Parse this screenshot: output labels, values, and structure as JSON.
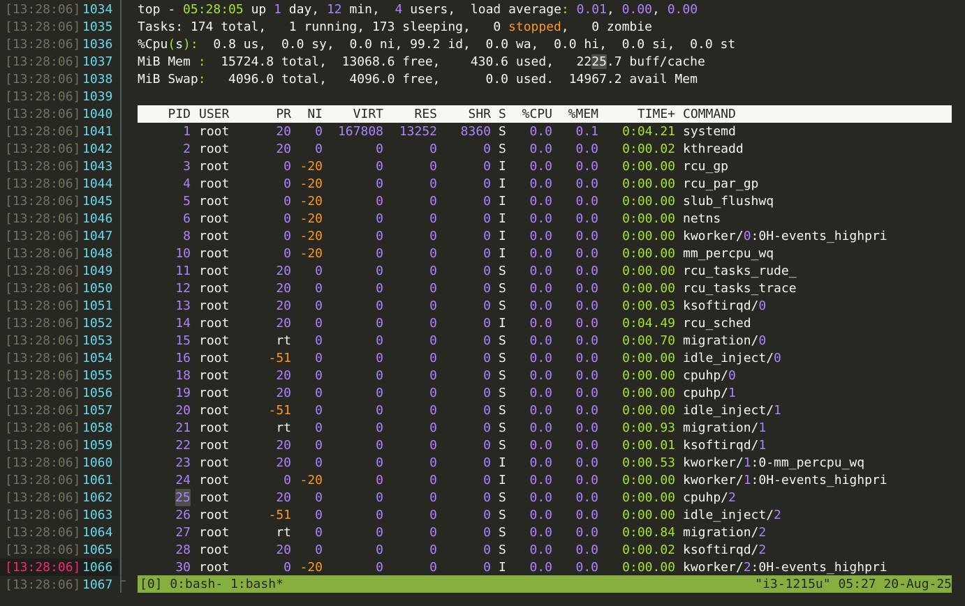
{
  "gutter": [
    {
      "ts": "[13:28:06]",
      "ln": "1034"
    },
    {
      "ts": "[13:28:06]",
      "ln": "1035"
    },
    {
      "ts": "[13:28:06]",
      "ln": "1036"
    },
    {
      "ts": "[13:28:06]",
      "ln": "1037"
    },
    {
      "ts": "[13:28:06]",
      "ln": "1038"
    },
    {
      "ts": "[13:28:06]",
      "ln": "1039"
    },
    {
      "ts": "[13:28:06]",
      "ln": "1040"
    },
    {
      "ts": "[13:28:06]",
      "ln": "1041"
    },
    {
      "ts": "[13:28:06]",
      "ln": "1042"
    },
    {
      "ts": "[13:28:06]",
      "ln": "1043"
    },
    {
      "ts": "[13:28:06]",
      "ln": "1044"
    },
    {
      "ts": "[13:28:06]",
      "ln": "1045"
    },
    {
      "ts": "[13:28:06]",
      "ln": "1046"
    },
    {
      "ts": "[13:28:06]",
      "ln": "1047"
    },
    {
      "ts": "[13:28:06]",
      "ln": "1048"
    },
    {
      "ts": "[13:28:06]",
      "ln": "1049"
    },
    {
      "ts": "[13:28:06]",
      "ln": "1050"
    },
    {
      "ts": "[13:28:06]",
      "ln": "1051"
    },
    {
      "ts": "[13:28:06]",
      "ln": "1052"
    },
    {
      "ts": "[13:28:06]",
      "ln": "1053"
    },
    {
      "ts": "[13:28:06]",
      "ln": "1054"
    },
    {
      "ts": "[13:28:06]",
      "ln": "1055"
    },
    {
      "ts": "[13:28:06]",
      "ln": "1056"
    },
    {
      "ts": "[13:28:06]",
      "ln": "1057"
    },
    {
      "ts": "[13:28:06]",
      "ln": "1058"
    },
    {
      "ts": "[13:28:06]",
      "ln": "1059"
    },
    {
      "ts": "[13:28:06]",
      "ln": "1060"
    },
    {
      "ts": "[13:28:06]",
      "ln": "1061"
    },
    {
      "ts": "[13:28:06]",
      "ln": "1062"
    },
    {
      "ts": "[13:28:06]",
      "ln": "1063"
    },
    {
      "ts": "[13:28:06]",
      "ln": "1064"
    },
    {
      "ts": "[13:28:06]",
      "ln": "1065"
    },
    {
      "ts": "[13:28:06]",
      "ln": "1066"
    },
    {
      "ts": "[13:28:06]",
      "ln": "1067"
    }
  ],
  "summary": {
    "top_prefix": "top - ",
    "time": "05:28:05",
    "up_label": " up ",
    "up_days": "1",
    "day_label": " day, ",
    "up_min": "12",
    "min_label": " min,  ",
    "users": "4",
    "users_label": " users,  load average",
    "colon": ":",
    "load1": "0.01",
    "comma1": ", ",
    "load5": "0.00",
    "comma2": ", ",
    "load15": "0.00",
    "tasks_label": "Tasks",
    "tasks_rest1": ": 174 total,   1 running, 173 sleeping,   0 ",
    "stopped": "stopped",
    "tasks_rest2": ",   0 zombie",
    "cpu_label": "%Cpu",
    "cpu_paren_open": "(",
    "cpu_s": "s",
    "cpu_paren_close": ")",
    "cpu_colon": ":",
    "cpu_rest1": "  0.8 us,  0.0 sy,  0.0 ni, 99.2 id,  0.0 wa,  0.0 ",
    "cpu_hi": "hi",
    "cpu_rest2": ",  0.0 si,  0.0 st",
    "mem_label": "MiB Mem ",
    "mem_colon": ":",
    "mem_rest1": "  15724.8 total,  13068.6 free,    430.6 used,   22",
    "mem_hl": "25",
    "mem_rest2": ".7 buff/cache",
    "swap_label": "MiB Swap",
    "swap_colon": ":",
    "swap_rest": "   4096.0 total,   4096.0 free,      0.0 used.  14967.2 avail Mem"
  },
  "header": {
    "pid": "PID",
    "user": "USER",
    "pr": "PR",
    "ni": "NI",
    "virt": "VIRT",
    "res": "RES",
    "shr": "SHR",
    "s": "S",
    "cpu": "%CPU",
    "mem": "%MEM",
    "time": "TIME+",
    "cmd": "COMMAND"
  },
  "processes": [
    {
      "pid": "1",
      "user": "root",
      "pr": "20",
      "ni": "0",
      "virt": "167808",
      "res": "13252",
      "shr": "8360",
      "s": "S",
      "cpu": "0.0",
      "mem": "0.1",
      "time": "0:04.21",
      "cmd": "systemd"
    },
    {
      "pid": "2",
      "user": "root",
      "pr": "20",
      "ni": "0",
      "virt": "0",
      "res": "0",
      "shr": "0",
      "s": "S",
      "cpu": "0.0",
      "mem": "0.0",
      "time": "0:00.02",
      "cmd": "kthreadd"
    },
    {
      "pid": "3",
      "user": "root",
      "pr": "0",
      "ni": "-20",
      "virt": "0",
      "res": "0",
      "shr": "0",
      "s": "I",
      "cpu": "0.0",
      "mem": "0.0",
      "time": "0:00.00",
      "cmd": "rcu_gp"
    },
    {
      "pid": "4",
      "user": "root",
      "pr": "0",
      "ni": "-20",
      "virt": "0",
      "res": "0",
      "shr": "0",
      "s": "I",
      "cpu": "0.0",
      "mem": "0.0",
      "time": "0:00.00",
      "cmd": "rcu_par_gp"
    },
    {
      "pid": "5",
      "user": "root",
      "pr": "0",
      "ni": "-20",
      "virt": "0",
      "res": "0",
      "shr": "0",
      "s": "I",
      "cpu": "0.0",
      "mem": "0.0",
      "time": "0:00.00",
      "cmd": "slub_flushwq"
    },
    {
      "pid": "6",
      "user": "root",
      "pr": "0",
      "ni": "-20",
      "virt": "0",
      "res": "0",
      "shr": "0",
      "s": "I",
      "cpu": "0.0",
      "mem": "0.0",
      "time": "0:00.00",
      "cmd": "netns"
    },
    {
      "pid": "8",
      "user": "root",
      "pr": "0",
      "ni": "-20",
      "virt": "0",
      "res": "0",
      "shr": "0",
      "s": "I",
      "cpu": "0.0",
      "mem": "0.0",
      "time": "0:00.00",
      "cmd": "kworker/0:0H-events_highpri"
    },
    {
      "pid": "10",
      "user": "root",
      "pr": "0",
      "ni": "-20",
      "virt": "0",
      "res": "0",
      "shr": "0",
      "s": "I",
      "cpu": "0.0",
      "mem": "0.0",
      "time": "0:00.00",
      "cmd": "mm_percpu_wq"
    },
    {
      "pid": "11",
      "user": "root",
      "pr": "20",
      "ni": "0",
      "virt": "0",
      "res": "0",
      "shr": "0",
      "s": "S",
      "cpu": "0.0",
      "mem": "0.0",
      "time": "0:00.00",
      "cmd": "rcu_tasks_rude_"
    },
    {
      "pid": "12",
      "user": "root",
      "pr": "20",
      "ni": "0",
      "virt": "0",
      "res": "0",
      "shr": "0",
      "s": "S",
      "cpu": "0.0",
      "mem": "0.0",
      "time": "0:00.00",
      "cmd": "rcu_tasks_trace"
    },
    {
      "pid": "13",
      "user": "root",
      "pr": "20",
      "ni": "0",
      "virt": "0",
      "res": "0",
      "shr": "0",
      "s": "S",
      "cpu": "0.0",
      "mem": "0.0",
      "time": "0:00.03",
      "cmd": "ksoftirqd/0"
    },
    {
      "pid": "14",
      "user": "root",
      "pr": "20",
      "ni": "0",
      "virt": "0",
      "res": "0",
      "shr": "0",
      "s": "I",
      "cpu": "0.0",
      "mem": "0.0",
      "time": "0:04.49",
      "cmd": "rcu_sched"
    },
    {
      "pid": "15",
      "user": "root",
      "pr": "rt",
      "ni": "0",
      "virt": "0",
      "res": "0",
      "shr": "0",
      "s": "S",
      "cpu": "0.0",
      "mem": "0.0",
      "time": "0:00.70",
      "cmd": "migration/0"
    },
    {
      "pid": "16",
      "user": "root",
      "pr": "-51",
      "ni": "0",
      "virt": "0",
      "res": "0",
      "shr": "0",
      "s": "S",
      "cpu": "0.0",
      "mem": "0.0",
      "time": "0:00.00",
      "cmd": "idle_inject/0"
    },
    {
      "pid": "18",
      "user": "root",
      "pr": "20",
      "ni": "0",
      "virt": "0",
      "res": "0",
      "shr": "0",
      "s": "S",
      "cpu": "0.0",
      "mem": "0.0",
      "time": "0:00.00",
      "cmd": "cpuhp/0"
    },
    {
      "pid": "19",
      "user": "root",
      "pr": "20",
      "ni": "0",
      "virt": "0",
      "res": "0",
      "shr": "0",
      "s": "S",
      "cpu": "0.0",
      "mem": "0.0",
      "time": "0:00.00",
      "cmd": "cpuhp/1"
    },
    {
      "pid": "20",
      "user": "root",
      "pr": "-51",
      "ni": "0",
      "virt": "0",
      "res": "0",
      "shr": "0",
      "s": "S",
      "cpu": "0.0",
      "mem": "0.0",
      "time": "0:00.00",
      "cmd": "idle_inject/1"
    },
    {
      "pid": "21",
      "user": "root",
      "pr": "rt",
      "ni": "0",
      "virt": "0",
      "res": "0",
      "shr": "0",
      "s": "S",
      "cpu": "0.0",
      "mem": "0.0",
      "time": "0:00.93",
      "cmd": "migration/1"
    },
    {
      "pid": "22",
      "user": "root",
      "pr": "20",
      "ni": "0",
      "virt": "0",
      "res": "0",
      "shr": "0",
      "s": "S",
      "cpu": "0.0",
      "mem": "0.0",
      "time": "0:00.01",
      "cmd": "ksoftirqd/1"
    },
    {
      "pid": "23",
      "user": "root",
      "pr": "20",
      "ni": "0",
      "virt": "0",
      "res": "0",
      "shr": "0",
      "s": "I",
      "cpu": "0.0",
      "mem": "0.0",
      "time": "0:00.53",
      "cmd": "kworker/1:0-mm_percpu_wq"
    },
    {
      "pid": "24",
      "user": "root",
      "pr": "0",
      "ni": "-20",
      "virt": "0",
      "res": "0",
      "shr": "0",
      "s": "I",
      "cpu": "0.0",
      "mem": "0.0",
      "time": "0:00.00",
      "cmd": "kworker/1:0H-events_highpri"
    },
    {
      "pid": "25",
      "user": "root",
      "pr": "20",
      "ni": "0",
      "virt": "0",
      "res": "0",
      "shr": "0",
      "s": "S",
      "cpu": "0.0",
      "mem": "0.0",
      "time": "0:00.00",
      "cmd": "cpuhp/2"
    },
    {
      "pid": "26",
      "user": "root",
      "pr": "-51",
      "ni": "0",
      "virt": "0",
      "res": "0",
      "shr": "0",
      "s": "S",
      "cpu": "0.0",
      "mem": "0.0",
      "time": "0:00.00",
      "cmd": "idle_inject/2"
    },
    {
      "pid": "27",
      "user": "root",
      "pr": "rt",
      "ni": "0",
      "virt": "0",
      "res": "0",
      "shr": "0",
      "s": "S",
      "cpu": "0.0",
      "mem": "0.0",
      "time": "0:00.84",
      "cmd": "migration/2"
    },
    {
      "pid": "28",
      "user": "root",
      "pr": "20",
      "ni": "0",
      "virt": "0",
      "res": "0",
      "shr": "0",
      "s": "S",
      "cpu": "0.0",
      "mem": "0.0",
      "time": "0:00.02",
      "cmd": "ksoftirqd/2"
    },
    {
      "pid": "30",
      "user": "root",
      "pr": "0",
      "ni": "-20",
      "virt": "0",
      "res": "0",
      "shr": "0",
      "s": "I",
      "cpu": "0.0",
      "mem": "0.0",
      "time": "0:00.00",
      "cmd": "kworker/2:0H-events_highpri"
    }
  ],
  "status_bar": {
    "left": "[0] 0:bash- 1:bash*",
    "right": "\"i3-1215u\" 05:27 20-Aug-25"
  },
  "colors": {
    "background": "#272822",
    "number": "#ae81ff",
    "time": "#a6e22e",
    "negative": "#fd971f",
    "timestamp": "#75715e",
    "line_number": "#66d9ef",
    "cursor_line": "#f92672",
    "status_bar": "#87af3f"
  }
}
